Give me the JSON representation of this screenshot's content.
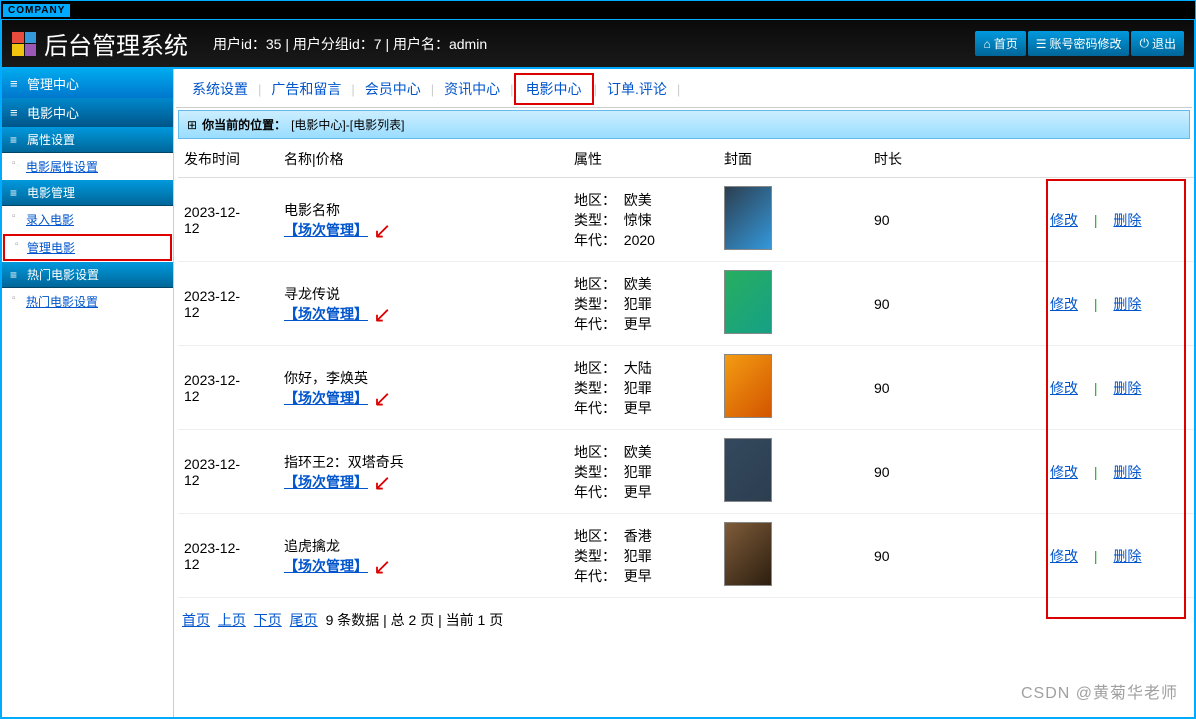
{
  "company_tag": "COMPANY",
  "app_title": "后台管理系统",
  "user_info": "用户id：35 | 用户分组id：7 | 用户名：admin",
  "header_actions": {
    "home": "首页",
    "password": "账号密码修改",
    "logout": "退出"
  },
  "sidebar": {
    "center_title": "管理中心",
    "module_title": "电影中心",
    "sections": [
      {
        "title": "属性设置",
        "items": [
          {
            "label": "电影属性设置"
          }
        ]
      },
      {
        "title": "电影管理",
        "items": [
          {
            "label": "录入电影"
          },
          {
            "label": "管理电影",
            "boxed": true
          }
        ]
      },
      {
        "title": "热门电影设置",
        "items": [
          {
            "label": "热门电影设置"
          }
        ]
      }
    ]
  },
  "tabs": [
    {
      "label": "系统设置"
    },
    {
      "label": "广告和留言"
    },
    {
      "label": "会员中心"
    },
    {
      "label": "资讯中心"
    },
    {
      "label": "电影中心",
      "active": true
    },
    {
      "label": "订单.评论"
    }
  ],
  "breadcrumb": {
    "prefix": "你当前的位置：",
    "path": "[电影中心]-[电影列表]"
  },
  "columns": {
    "time": "发布时间",
    "name": "名称|价格",
    "attr": "属性",
    "cover": "封面",
    "duration": "时长"
  },
  "schedule_label": "【场次管理】",
  "attr_labels": {
    "region": "地区：",
    "type": "类型：",
    "era": "年代："
  },
  "actions": {
    "edit": "修改",
    "delete": "删除"
  },
  "rows": [
    {
      "time": "2023-12-12",
      "name": "电影名称",
      "region": "欧美",
      "type": "惊悚",
      "era": "2020",
      "duration": "90"
    },
    {
      "time": "2023-12-12",
      "name": "寻龙传说",
      "region": "欧美",
      "type": "犯罪",
      "era": "更早",
      "duration": "90"
    },
    {
      "time": "2023-12-12",
      "name": "你好，李焕英",
      "region": "大陆",
      "type": "犯罪",
      "era": "更早",
      "duration": "90"
    },
    {
      "time": "2023-12-12",
      "name": "指环王2：双塔奇兵",
      "region": "欧美",
      "type": "犯罪",
      "era": "更早",
      "duration": "90"
    },
    {
      "time": "2023-12-12",
      "name": "追虎擒龙",
      "region": "香港",
      "type": "犯罪",
      "era": "更早",
      "duration": "90"
    }
  ],
  "pager": {
    "first": "首页",
    "prev": "上页",
    "next": "下页",
    "last": "尾页",
    "info": "9 条数据 | 总 2 页 | 当前 1 页"
  },
  "watermark": "CSDN @黄菊华老师"
}
